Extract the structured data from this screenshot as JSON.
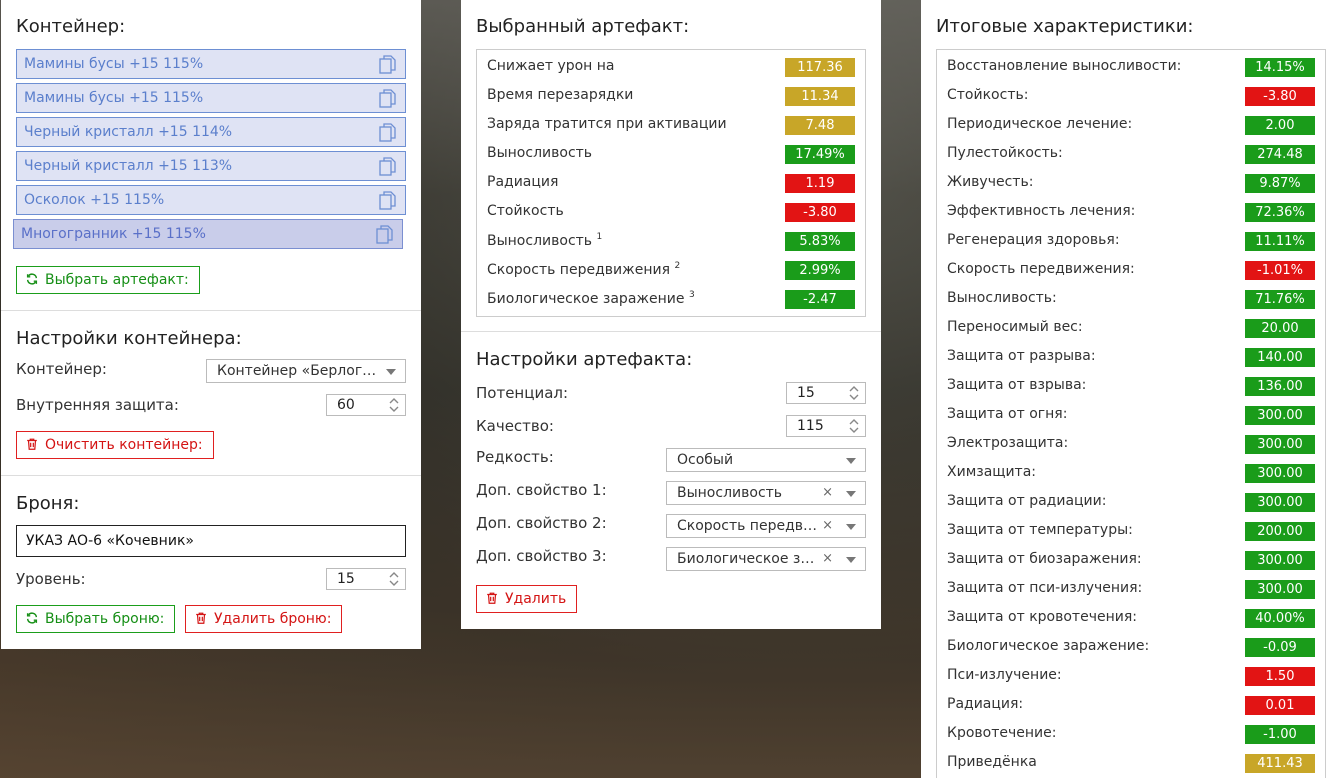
{
  "colors": {
    "green": "#1a9c1a",
    "red": "#e21414",
    "gold": "#c8a628",
    "link_blue": "#5b7fcc"
  },
  "container_panel": {
    "title": "Контейнер:",
    "items": [
      {
        "label": "Мамины бусы +15 115%",
        "icon": "copy-icon"
      },
      {
        "label": "Мамины бусы +15 115%",
        "icon": "copy-icon"
      },
      {
        "label": "Черный кристалл +15 114%",
        "icon": "copy-icon"
      },
      {
        "label": "Черный кристалл +15 113%",
        "icon": "copy-icon"
      },
      {
        "label": "Осколок +15 115%",
        "icon": "copy-icon"
      },
      {
        "label": "Многогранник +15 115%",
        "icon": "copy-icon"
      }
    ],
    "select_artifact_button": "Выбрать артефакт:",
    "settings_title": "Настройки контейнера:",
    "container_label": "Контейнер:",
    "container_value": "Контейнер «Берлога…",
    "protection_label": "Внутренняя защита:",
    "protection_value": "60",
    "clear_button": "Очистить контейнер:",
    "armor_title": "Броня:",
    "armor_value": "УКАЗ АО-6 «Кочевник»",
    "level_label": "Уровень:",
    "level_value": "15",
    "select_armor_button": "Выбрать броню:",
    "delete_armor_button": "Удалить броню:"
  },
  "artifact_panel": {
    "title": "Выбранный артефакт:",
    "stats": [
      {
        "label": "Снижает урон на",
        "sup": "",
        "value": "117.36",
        "color": "gold"
      },
      {
        "label": "Время перезарядки",
        "sup": "",
        "value": "11.34",
        "color": "gold"
      },
      {
        "label": "Заряда тратится при активации",
        "sup": "",
        "value": "7.48",
        "color": "gold"
      },
      {
        "label": "Выносливость",
        "sup": "",
        "value": "17.49%",
        "color": "green"
      },
      {
        "label": "Радиация",
        "sup": "",
        "value": "1.19",
        "color": "red"
      },
      {
        "label": "Стойкость",
        "sup": "",
        "value": "-3.80",
        "color": "red"
      },
      {
        "label": "Выносливость",
        "sup": "1",
        "value": "5.83%",
        "color": "green"
      },
      {
        "label": "Скорость передвижения",
        "sup": "2",
        "value": "2.99%",
        "color": "green"
      },
      {
        "label": "Биологическое заражение",
        "sup": "3",
        "value": "-2.47",
        "color": "green"
      }
    ],
    "settings_title": "Настройки артефакта:",
    "potential_label": "Потенциал:",
    "potential_value": "15",
    "quality_label": "Качество:",
    "quality_value": "115",
    "rarity_label": "Редкость:",
    "rarity_value": "Особый",
    "prop1_label": "Доп. свойство 1:",
    "prop1_value": "Выносливость",
    "prop2_label": "Доп. свойство 2:",
    "prop2_value": "Скорость передви…",
    "prop3_label": "Доп. свойство 3:",
    "prop3_value": "Биологическое за…",
    "clear_symbol": "×",
    "delete_button": "Удалить"
  },
  "totals_panel": {
    "title": "Итоговые характеристики:",
    "stats": [
      {
        "label": "Восстановление выносливости:",
        "value": "14.15%",
        "color": "green"
      },
      {
        "label": "Стойкость:",
        "value": "-3.80",
        "color": "red"
      },
      {
        "label": "Периодическое лечение:",
        "value": "2.00",
        "color": "green"
      },
      {
        "label": "Пулестойкость:",
        "value": "274.48",
        "color": "green"
      },
      {
        "label": "Живучесть:",
        "value": "9.87%",
        "color": "green"
      },
      {
        "label": "Эффективность лечения:",
        "value": "72.36%",
        "color": "green"
      },
      {
        "label": "Регенерация здоровья:",
        "value": "11.11%",
        "color": "green"
      },
      {
        "label": "Скорость передвижения:",
        "value": "-1.01%",
        "color": "red"
      },
      {
        "label": "Выносливость:",
        "value": "71.76%",
        "color": "green"
      },
      {
        "label": "Переносимый вес:",
        "value": "20.00",
        "color": "green"
      },
      {
        "label": "Защита от разрыва:",
        "value": "140.00",
        "color": "green"
      },
      {
        "label": "Защита от взрыва:",
        "value": "136.00",
        "color": "green"
      },
      {
        "label": "Защита от огня:",
        "value": "300.00",
        "color": "green"
      },
      {
        "label": "Электрозащита:",
        "value": "300.00",
        "color": "green"
      },
      {
        "label": "Химзащита:",
        "value": "300.00",
        "color": "green"
      },
      {
        "label": "Защита от радиации:",
        "value": "300.00",
        "color": "green"
      },
      {
        "label": "Защита от температуры:",
        "value": "200.00",
        "color": "green"
      },
      {
        "label": "Защита от биозаражения:",
        "value": "300.00",
        "color": "green"
      },
      {
        "label": "Защита от пси-излучения:",
        "value": "300.00",
        "color": "green"
      },
      {
        "label": "Защита от кровотечения:",
        "value": "40.00%",
        "color": "green"
      },
      {
        "label": "Биологическое заражение:",
        "value": "-0.09",
        "color": "green"
      },
      {
        "label": "Пси-излучение:",
        "value": "1.50",
        "color": "red"
      },
      {
        "label": "Радиация:",
        "value": "0.01",
        "color": "red"
      },
      {
        "label": "Кровотечение:",
        "value": "-1.00",
        "color": "green"
      },
      {
        "label": "Приведёнка",
        "value": "411.43",
        "color": "gold"
      }
    ]
  }
}
